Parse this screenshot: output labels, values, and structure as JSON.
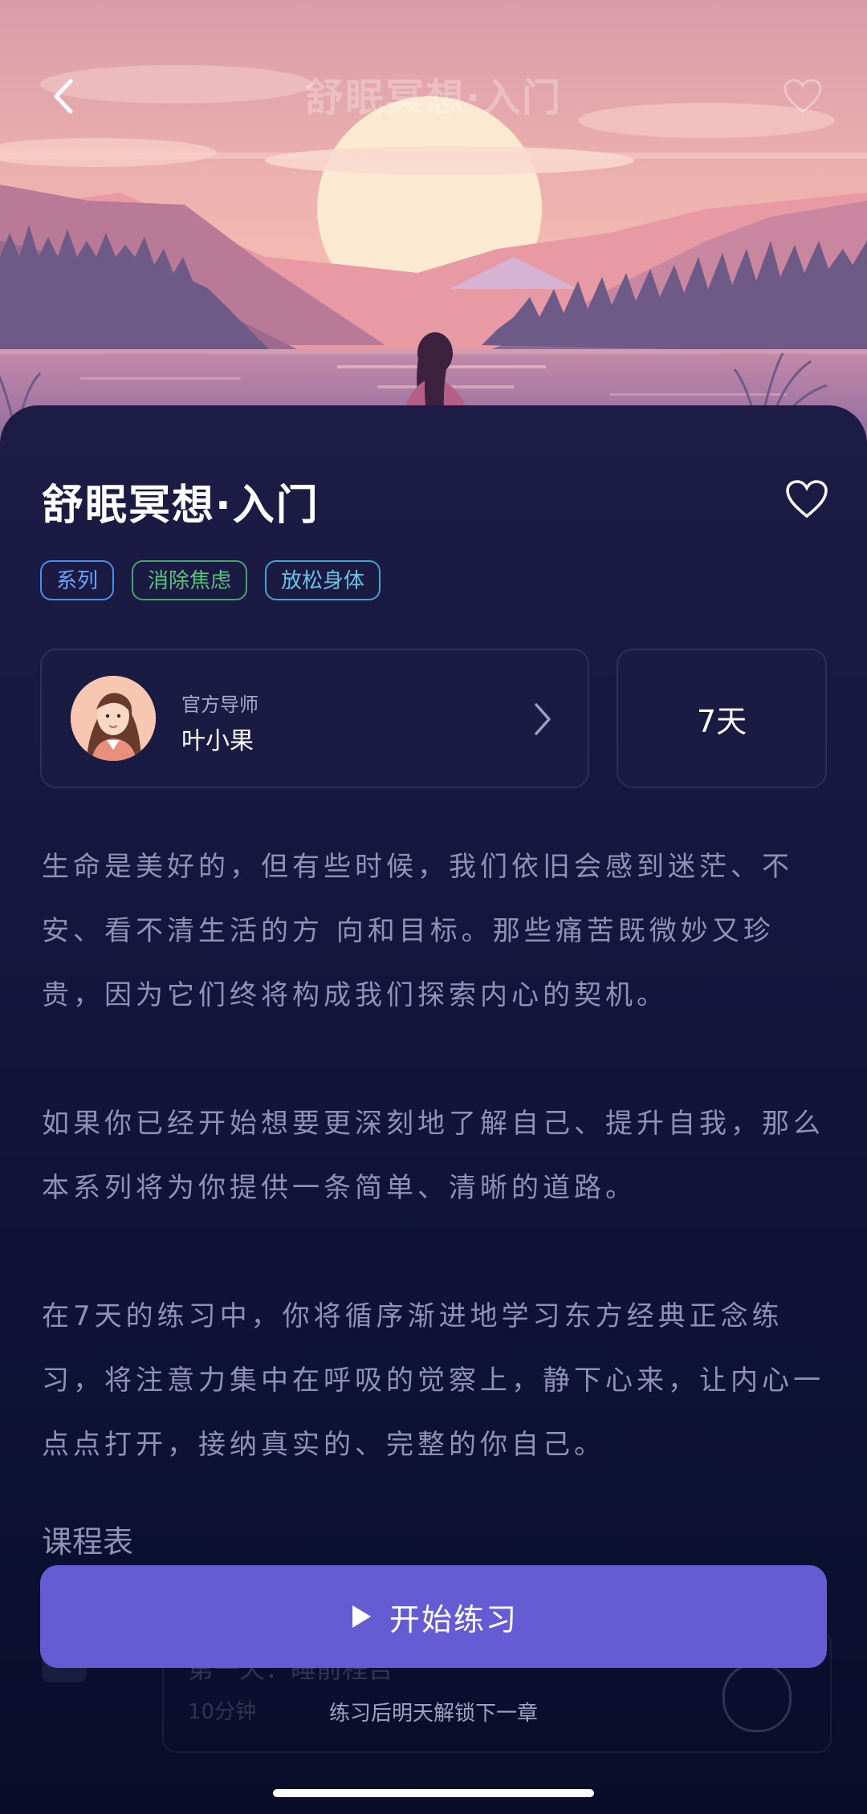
{
  "header": {
    "title": "舒眠冥想·入门"
  },
  "course": {
    "title": "舒眠冥想·入门",
    "tags": [
      "系列",
      "消除焦虑",
      "放松身体"
    ],
    "teacher_role": "官方导师",
    "teacher_name": "叶小果",
    "duration": "7天",
    "description": [
      "生命是美好的，但有些时候，我们依旧会感到迷茫、不安、看不清生活的方 向和目标。那些痛苦既微妙又珍贵，因为它们终将构成我们探索内心的契机。",
      "如果你已经开始想要更深刻地了解自己、提升自我，那么本系列将为你提供一条简单、清晰的道路。",
      "在7天的练习中，你将循序渐进地学习东方经典正念练习，将注意力集中在呼吸的觉察上，静下心来，让内心一点点打开，接纳真实的、完整的你自己。"
    ]
  },
  "schedule": {
    "title": "课程表",
    "first_lesson": {
      "title": "第一天：睡前程告",
      "duration": "10分钟"
    }
  },
  "footer": {
    "start_label": "开始练习",
    "hint": "练习后明天解锁下一章"
  },
  "colors": {
    "accent": "#655bd3",
    "background": "#0f0f33"
  },
  "icons": {
    "back": "chevron-left-icon",
    "favorite": "heart-outline-icon",
    "play": "play-icon",
    "arrow": "chevron-right-icon"
  }
}
